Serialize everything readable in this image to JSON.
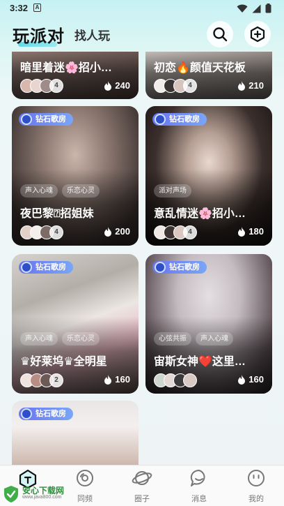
{
  "status_bar": {
    "time": "3:32",
    "notif_letter": "A"
  },
  "header": {
    "main_tab": "玩派对",
    "second_tab": "找人玩"
  },
  "top_cards": [
    {
      "title": "暗里着迷🌸招小…",
      "count": "4",
      "heat": "240"
    },
    {
      "title": "初恋🔥颜值天花板",
      "count": "4",
      "heat": "210"
    }
  ],
  "cards": [
    {
      "badge": "钻石歌房",
      "tags": [
        "声入心魂",
        "乐恋心灵"
      ],
      "title": "夜巴黎⍰招姐妹",
      "count": "4",
      "heat": "200"
    },
    {
      "badge": "钻石歌房",
      "tags": [
        "派对声场"
      ],
      "title": "意乱情迷🌸招小…",
      "count": "4",
      "heat": "180"
    },
    {
      "badge": "钻石歌房",
      "tags": [
        "声入心魂",
        "乐恋心灵"
      ],
      "title": "♛好莱坞♛全明星",
      "count": "2",
      "heat": "160"
    },
    {
      "badge": "钻石歌房",
      "tags": [
        "心弦共振",
        "声入心魂"
      ],
      "title": "宙斯女神❤️这里…",
      "count": "",
      "heat": "160"
    },
    {
      "badge": "钻石歌房"
    }
  ],
  "nav": [
    {
      "label": ""
    },
    {
      "label": "同频"
    },
    {
      "label": "圈子"
    },
    {
      "label": "消息"
    },
    {
      "label": "我的"
    }
  ],
  "watermark": {
    "text": "安心下载网",
    "sub": "www.java800.com"
  }
}
